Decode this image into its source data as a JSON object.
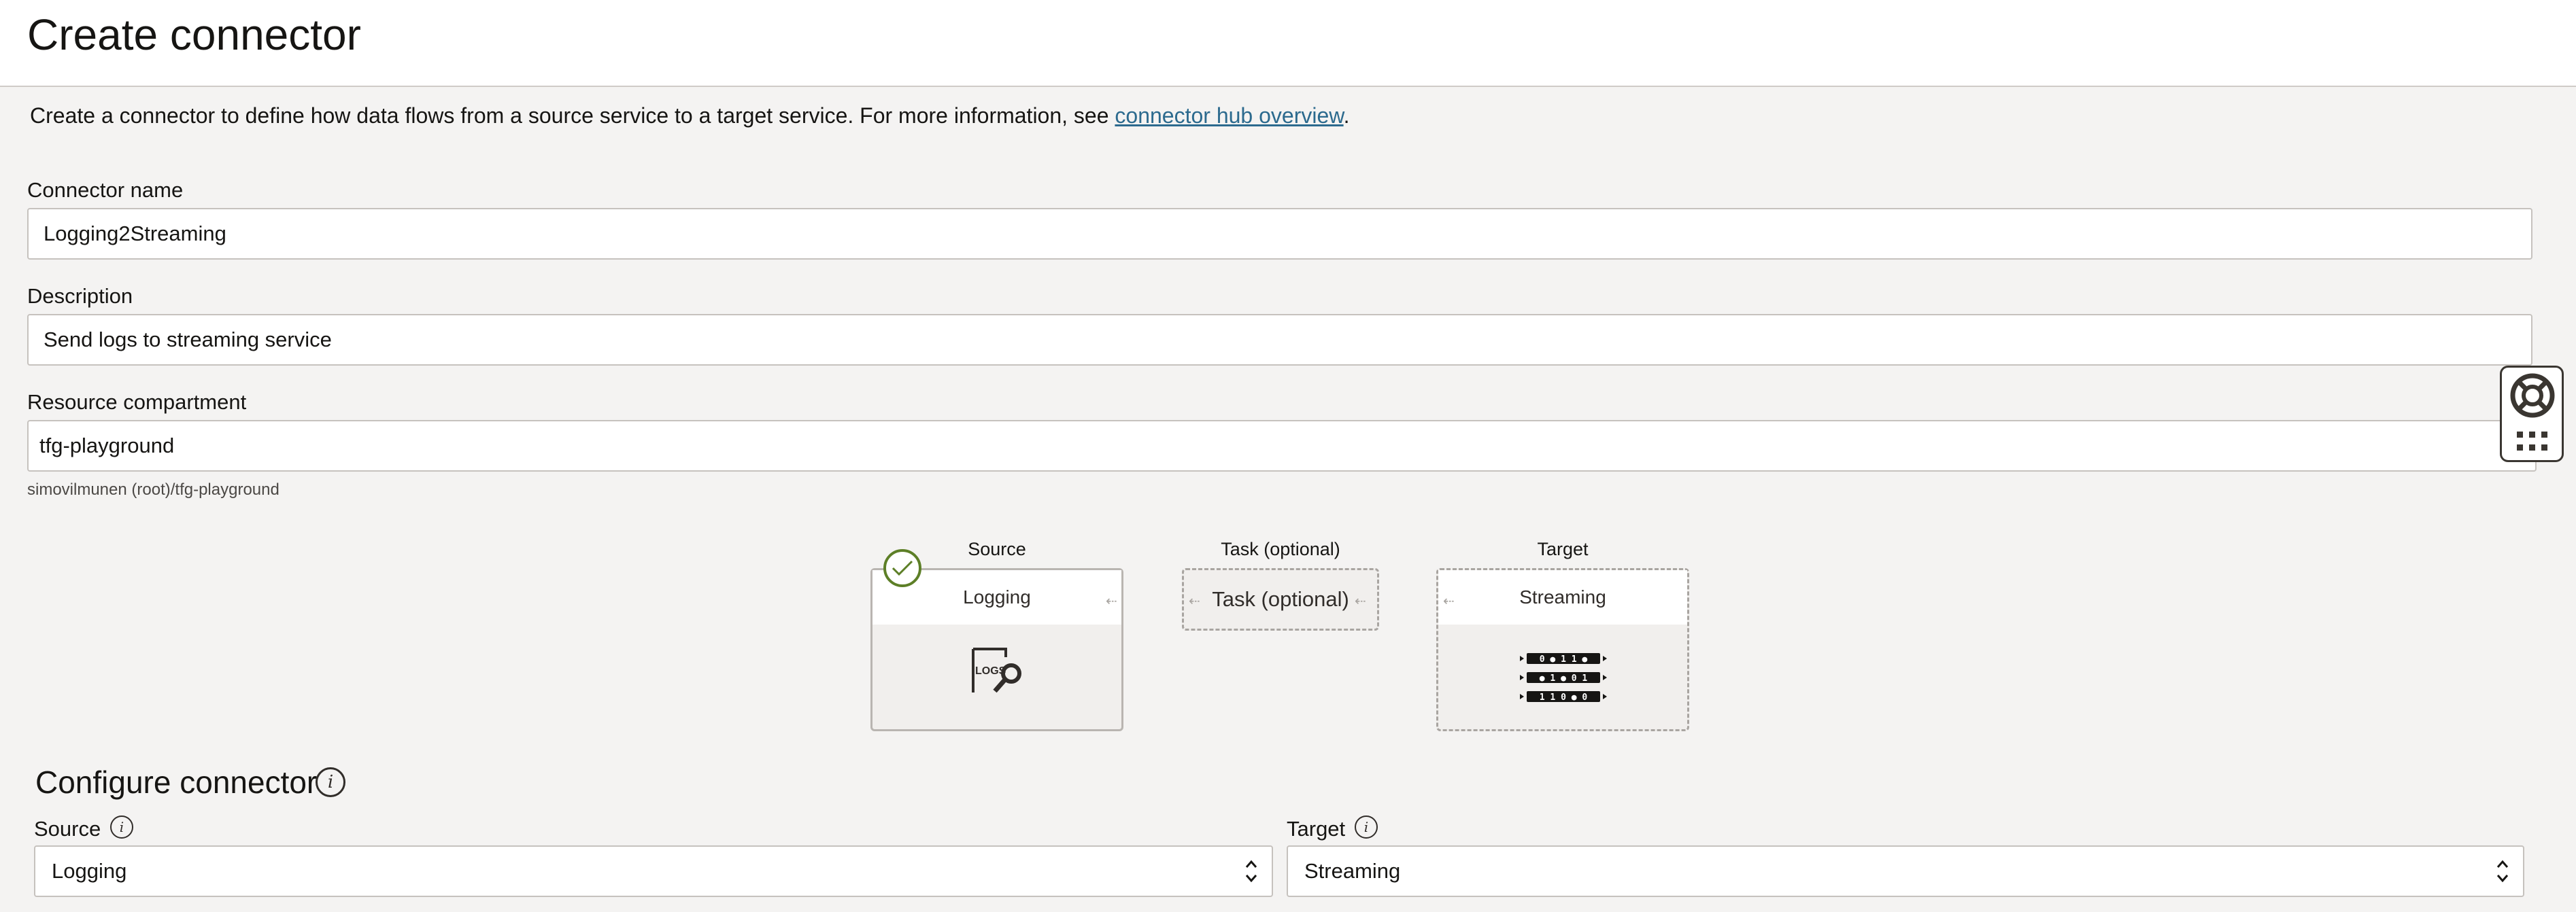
{
  "header": {
    "title": "Create connector"
  },
  "intro": {
    "text": "Create a connector to define how data flows from a source service to a target service. For more information, see ",
    "link": "connector hub overview",
    "suffix": "."
  },
  "form": {
    "connector_name": {
      "label": "Connector name",
      "value": "Logging2Streaming"
    },
    "description": {
      "label": "Description",
      "value": "Send logs to streaming service"
    },
    "compartment": {
      "label": "Resource compartment",
      "value": "tfg-playground",
      "path": "simovilmunen (root)/tfg-playground"
    }
  },
  "flow": {
    "source": {
      "stage": "Source",
      "service": "Logging",
      "icon": "logs-search-icon",
      "status": "complete"
    },
    "task": {
      "stage": "Task (optional)",
      "label": "Task (optional)"
    },
    "target": {
      "stage": "Target",
      "service": "Streaming",
      "icon": "stream-icon",
      "stream_rows": [
        "0 ● 1 1 ●",
        "● 1 ● 0 1",
        "1 1 0 ● 0"
      ]
    }
  },
  "configure": {
    "title": "Configure connector",
    "source": {
      "label": "Source",
      "selected": "Logging"
    },
    "target": {
      "label": "Target",
      "selected": "Streaming"
    }
  },
  "colors": {
    "link": "#2c6a8e",
    "success": "#5d7f27",
    "background": "#f4f3f2"
  },
  "icons": [
    "check-icon",
    "info-icon",
    "lifebuoy-icon",
    "apps-grid-icon",
    "chevron-updown-icon"
  ]
}
